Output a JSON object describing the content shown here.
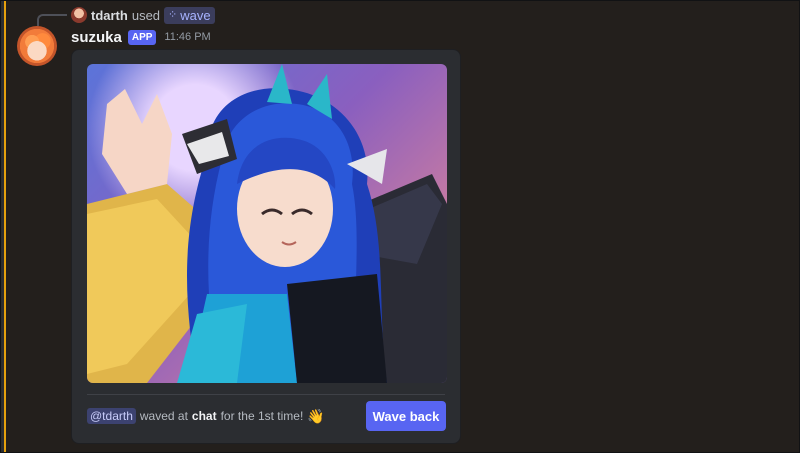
{
  "reply": {
    "user": "tdarth",
    "verb": "used",
    "command_icon": "slash-command-icon",
    "command": "wave"
  },
  "message": {
    "author": "suzuka",
    "badge": "APP",
    "time": "11:46 PM"
  },
  "card": {
    "image_subject": "anime-character-waving",
    "mention": "@tdarth",
    "text_before": "waved at",
    "bold_word": "chat",
    "text_after": "for the 1st time!",
    "emoji": "👋",
    "button_label": "Wave back"
  },
  "colors": {
    "accent": "#5865f2",
    "highlight_bar": "#e5a00d",
    "background": "#231f1c"
  }
}
